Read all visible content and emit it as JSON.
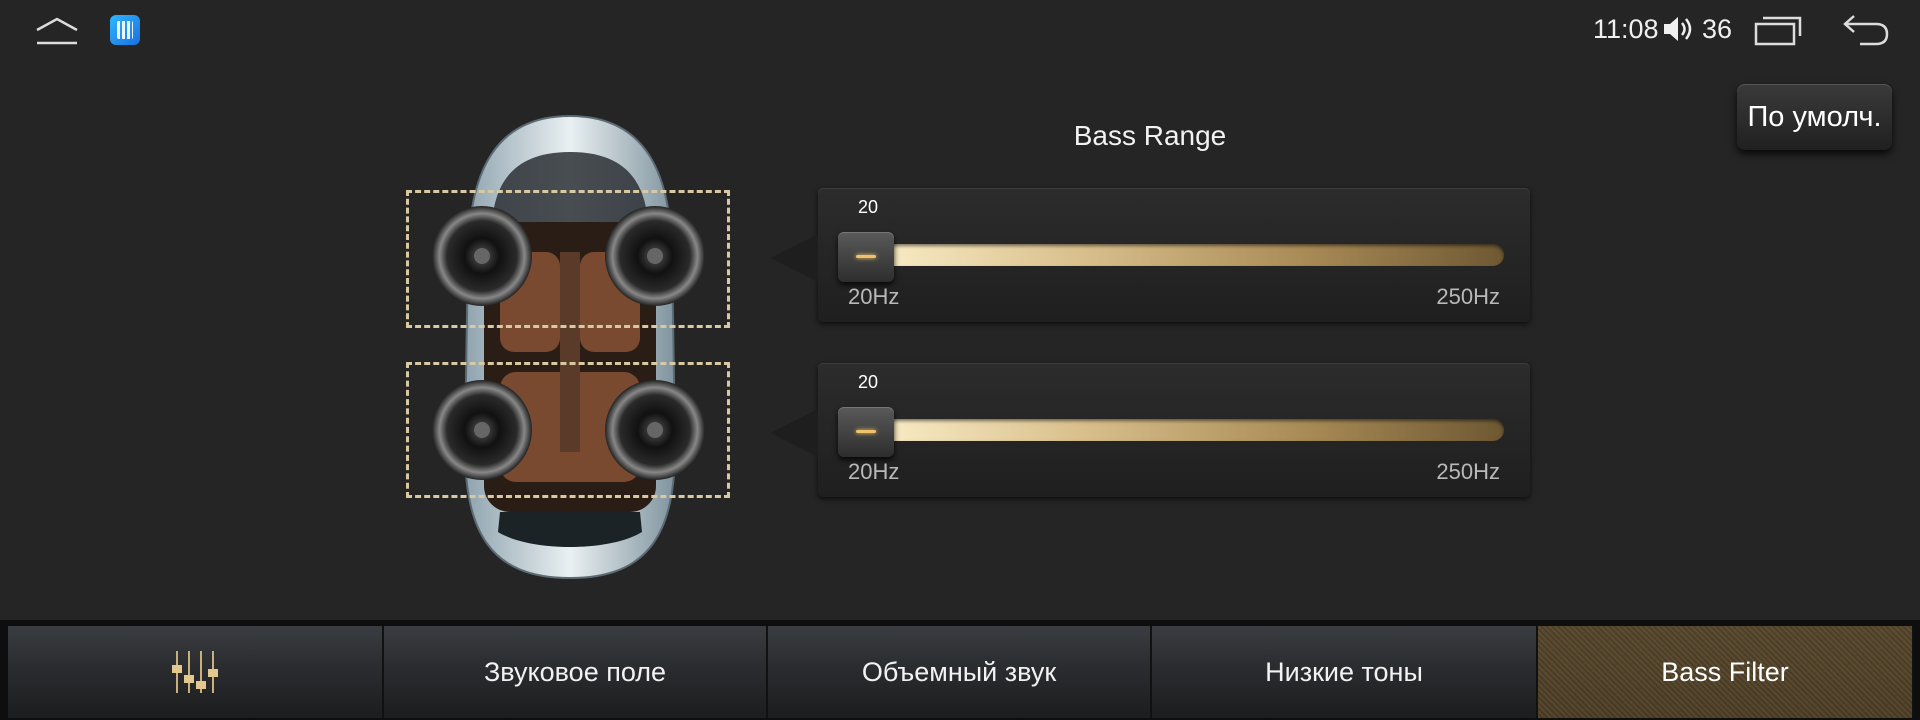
{
  "status_bar": {
    "clock": "11:08",
    "volume_level": "36",
    "icons": [
      "home-icon",
      "app-icon",
      "volume-icon",
      "recents-icon",
      "back-icon"
    ]
  },
  "default_button": {
    "label": "По умолч."
  },
  "panel": {
    "title": "Bass Range"
  },
  "sliders": [
    {
      "value": "20",
      "min_label": "20Hz",
      "max_label": "250Hz",
      "position_fraction": 0.0
    },
    {
      "value": "20",
      "min_label": "20Hz",
      "max_label": "250Hz",
      "position_fraction": 0.0
    }
  ],
  "tabs": [
    {
      "label": "",
      "icon": "equalizer-icon",
      "active": false
    },
    {
      "label": "Звуковое поле",
      "active": false
    },
    {
      "label": "Объемный звук",
      "active": false
    },
    {
      "label": "Низкие тоны",
      "active": false
    },
    {
      "label": "Bass Filter",
      "active": true
    }
  ],
  "colors": {
    "background": "#252525",
    "accent_gold": "#d9c08d",
    "zone_outline": "#d9c9a3"
  }
}
